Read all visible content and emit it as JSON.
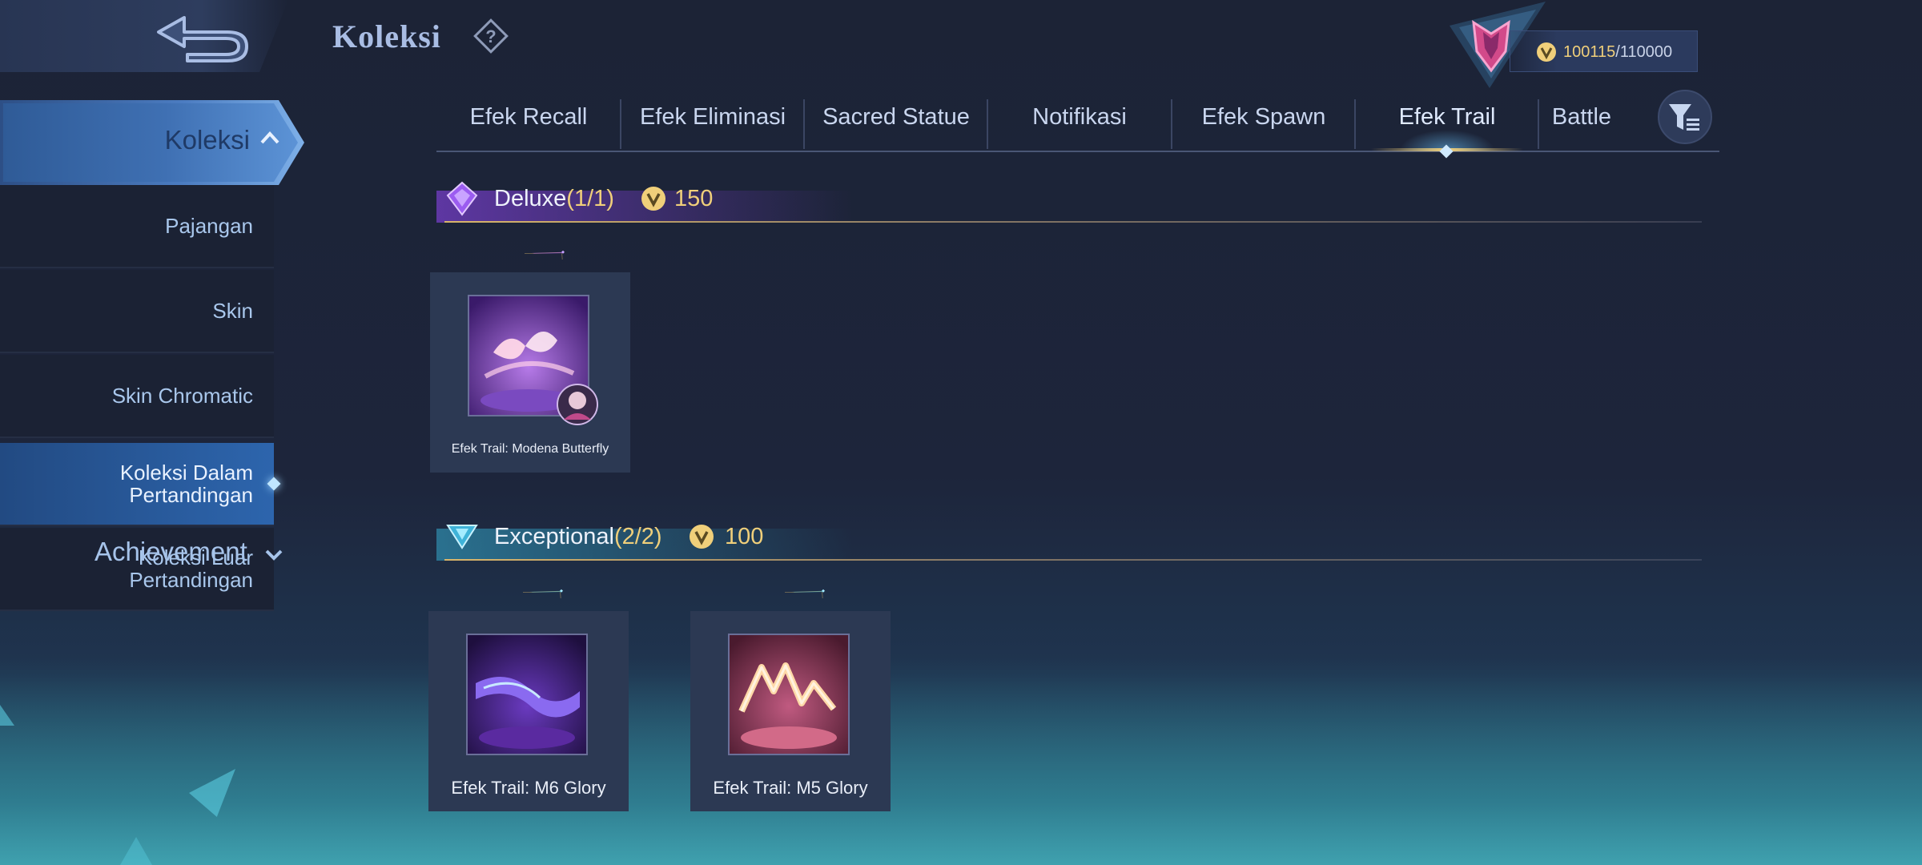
{
  "header": {
    "title": "Koleksi",
    "points_current": "100115",
    "points_max": "/110000"
  },
  "sidebar": {
    "heading": "Koleksi",
    "items": [
      {
        "label": "Pajangan",
        "active": false
      },
      {
        "label": "Skin",
        "active": false
      },
      {
        "label": "Skin Chromatic",
        "active": false
      },
      {
        "label": "Koleksi Dalam\nPertandingan",
        "active": true
      },
      {
        "label": "Koleksi Luar\nPertandingan",
        "active": false
      }
    ],
    "achievement": "Achievement"
  },
  "tabs": [
    {
      "label": "Efek Recall"
    },
    {
      "label": "Efek Eliminasi"
    },
    {
      "label": "Sacred Statue"
    },
    {
      "label": "Notifikasi"
    },
    {
      "label": "Efek Spawn"
    },
    {
      "label": "Efek Trail",
      "active": true
    },
    {
      "label": "Battle"
    }
  ],
  "sections": {
    "deluxe": {
      "title": "Deluxe",
      "count": "(1/1)",
      "points": "150",
      "items": [
        {
          "name": "Efek Trail: Modena Butterfly"
        }
      ]
    },
    "exceptional": {
      "title": "Exceptional",
      "count": "(2/2)",
      "points": "100",
      "items": [
        {
          "name": "Efek Trail: M6 Glory"
        },
        {
          "name": "Efek Trail: M5 Glory"
        }
      ]
    }
  },
  "colors": {
    "gold": "#f0cf7a",
    "active_blue": "#2d65ad",
    "deluxe_purple": "#9b5cf0",
    "exceptional_teal": "#5fd6ea"
  },
  "icons": [
    "back-arrow-icon",
    "help-icon",
    "rank-emblem-icon",
    "coin-icon",
    "chevron-up-icon",
    "chevron-down-icon",
    "filter-icon",
    "deluxe-gem-icon",
    "exceptional-gem-icon"
  ]
}
